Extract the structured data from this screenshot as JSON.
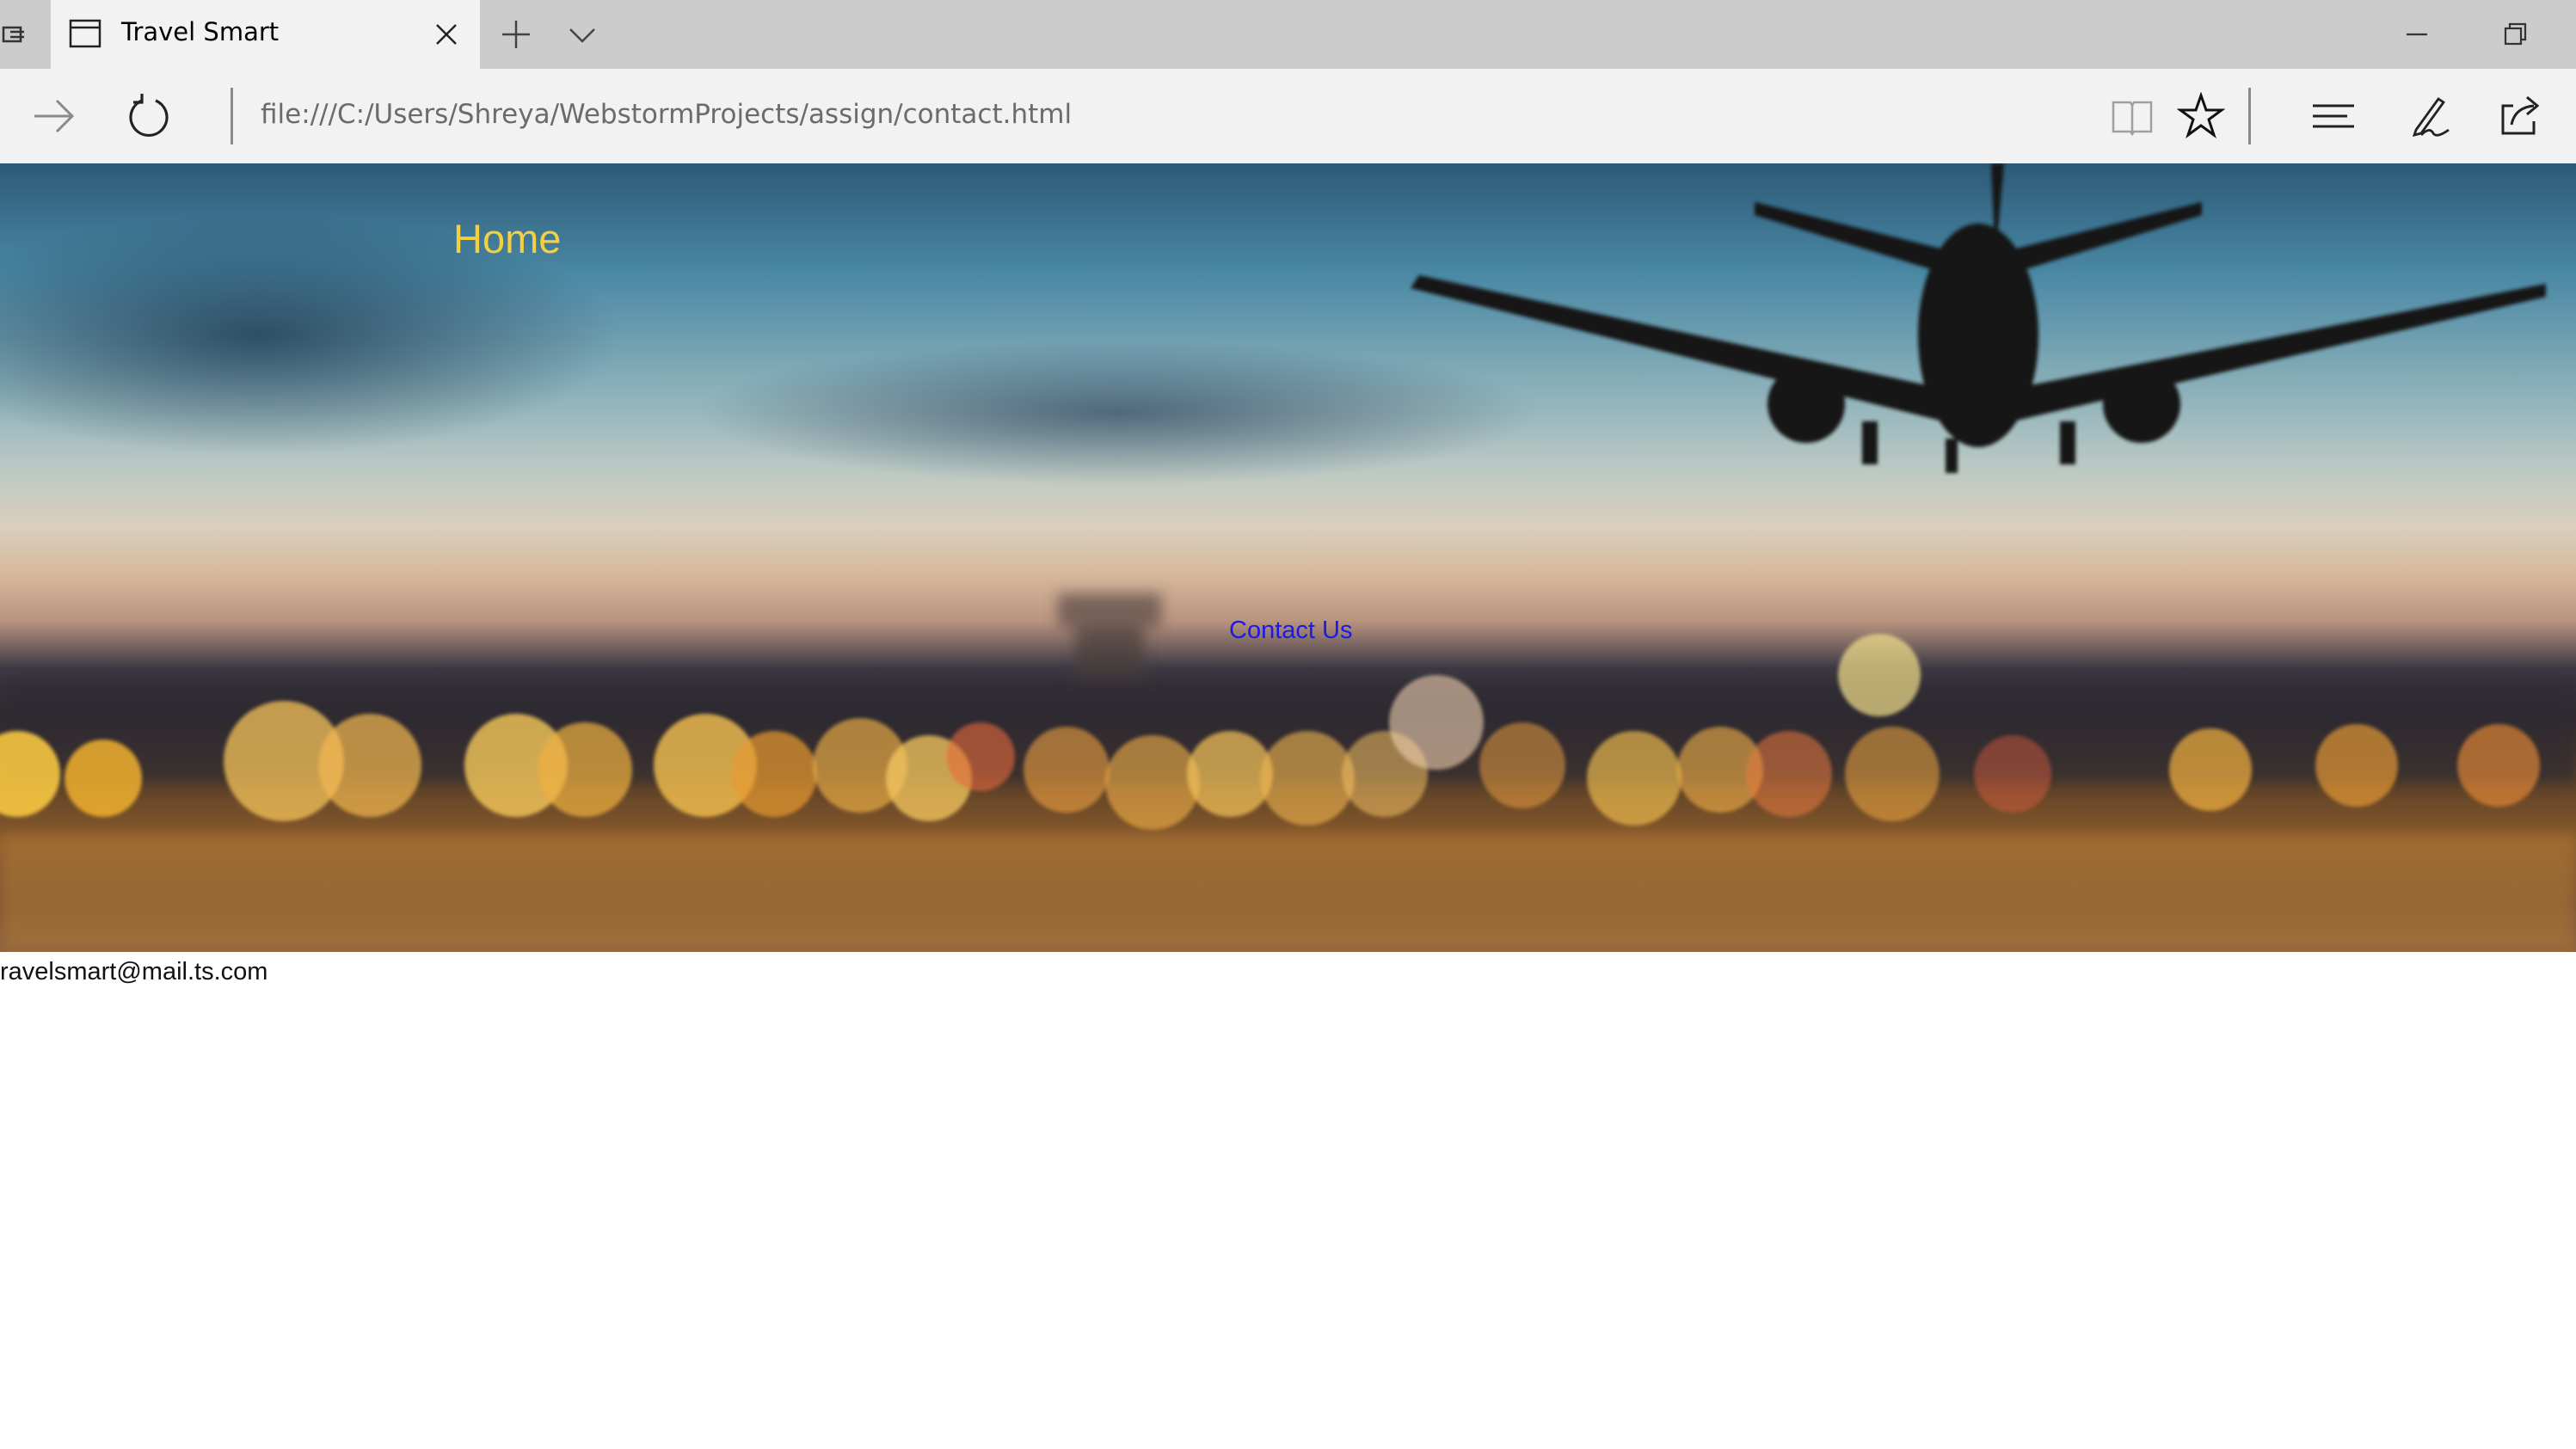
{
  "browser": {
    "tab_title": "Travel Smart",
    "address": "file:///C:/Users/Shreya/WebstormProjects/assign/contact.html",
    "icons": {
      "tab_list": "tab-list-icon",
      "tab_page": "page-icon",
      "tab_close": "close-icon",
      "new_tab": "plus-icon",
      "tab_dropdown": "chevron-down-icon",
      "minimize": "minimize-icon",
      "restore": "restore-icon",
      "forward": "forward-arrow-icon",
      "refresh": "refresh-icon",
      "reading_view": "book-icon",
      "favorite": "star-icon",
      "hub": "hub-icon",
      "web_note": "pen-icon",
      "share": "share-icon"
    }
  },
  "page": {
    "nav": {
      "home": "Home",
      "contact": "Contact Us"
    },
    "email": "ravelsmart@mail.ts.com",
    "colors": {
      "home_link": "#f4cf3f",
      "contact_link": "#1a1ae6",
      "email_text": "#111111"
    }
  }
}
